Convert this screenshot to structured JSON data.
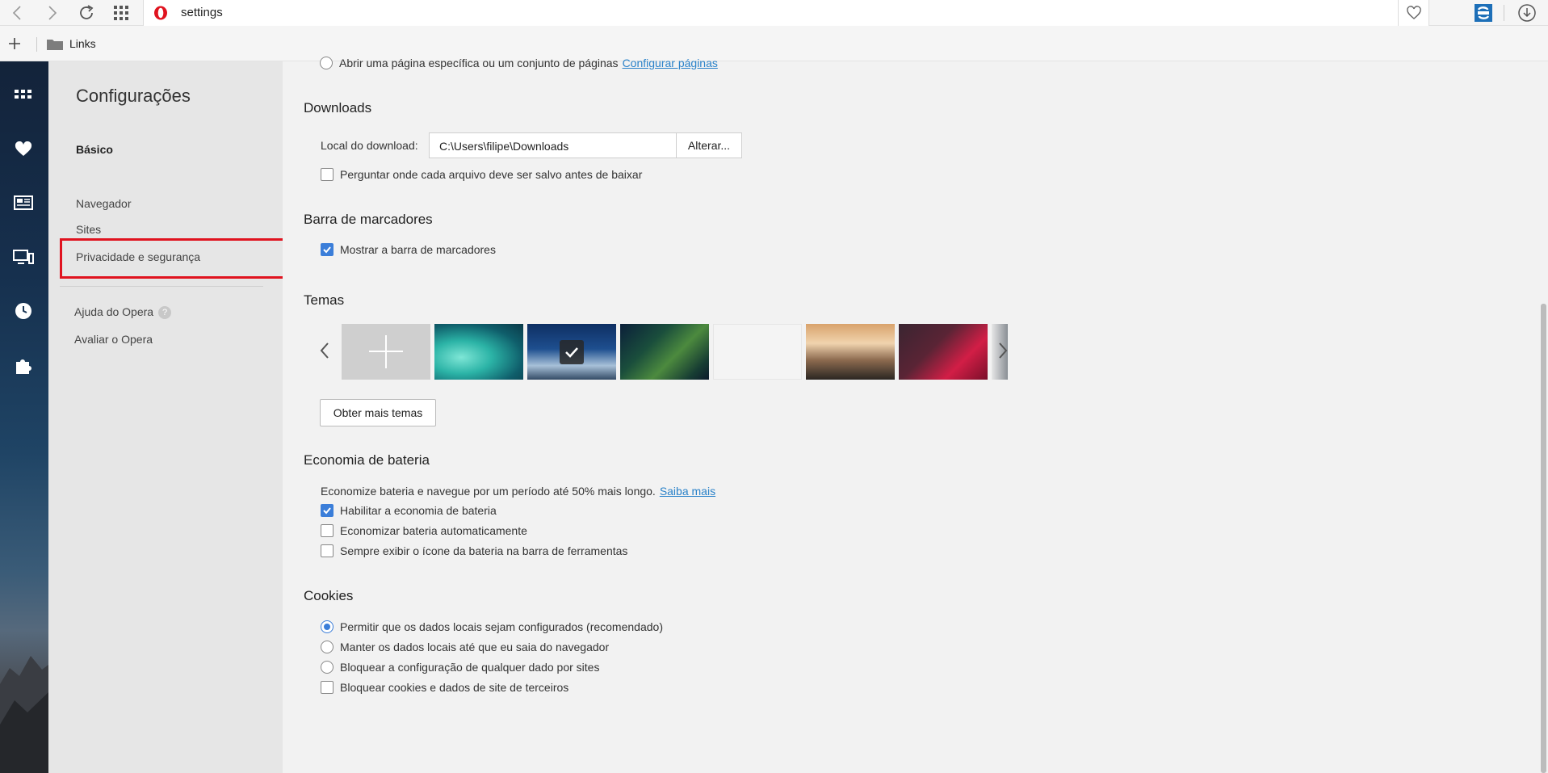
{
  "toolbar": {
    "url": "settings"
  },
  "bookmarks": {
    "folder_label": "Links"
  },
  "nav": {
    "title": "Configurações",
    "section": "Básico",
    "items": [
      {
        "label": "Navegador"
      },
      {
        "label": "Sites"
      },
      {
        "label": "Privacidade e segurança"
      }
    ],
    "help_label": "Ajuda do Opera",
    "rate_label": "Avaliar o Opera"
  },
  "main": {
    "startup_partial": {
      "label": "Abrir uma página específica ou um conjunto de páginas",
      "link": "Configurar páginas"
    },
    "downloads": {
      "title": "Downloads",
      "location_label": "Local do download:",
      "location_value": "C:\\Users\\filipe\\Downloads",
      "change_button": "Alterar...",
      "ask_label": "Perguntar onde cada arquivo deve ser salvo antes de baixar",
      "ask_checked": false
    },
    "bookmarks_bar": {
      "title": "Barra de marcadores",
      "show_label": "Mostrar a barra de marcadores",
      "show_checked": true
    },
    "themes": {
      "title": "Temas",
      "more_button": "Obter mais temas",
      "selected_index": 2
    },
    "battery": {
      "title": "Economia de bateria",
      "description": "Economize bateria e navegue por um período até 50% mais longo.",
      "learn_more": "Saiba mais",
      "options": [
        {
          "label": "Habilitar a economia de bateria",
          "checked": true
        },
        {
          "label": "Economizar bateria automaticamente",
          "checked": false
        },
        {
          "label": "Sempre exibir o ícone da bateria na barra de ferramentas",
          "checked": false
        }
      ]
    },
    "cookies": {
      "title": "Cookies",
      "options": [
        {
          "label": "Permitir que os dados locais sejam configurados (recomendado)",
          "type": "radio",
          "checked": true
        },
        {
          "label": "Manter os dados locais até que eu saia do navegador",
          "type": "radio",
          "checked": false
        },
        {
          "label": "Bloquear a configuração de qualquer dado por sites",
          "type": "radio",
          "checked": false
        },
        {
          "label": "Bloquear cookies e dados de site de terceiros",
          "type": "checkbox",
          "checked": false
        }
      ]
    }
  },
  "colors": {
    "accent": "#3b7ed9",
    "link": "#2a82c9",
    "highlight_box": "#e0131f"
  }
}
